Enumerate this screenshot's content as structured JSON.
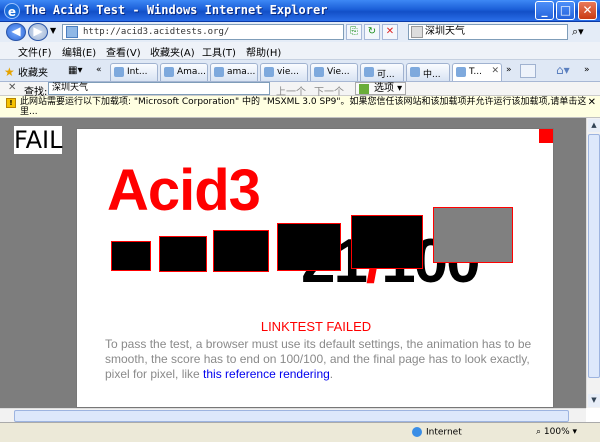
{
  "window": {
    "title": "The Acid3 Test - Windows Internet Explorer"
  },
  "address": {
    "url": "http://acid3.acidtests.org/",
    "search_value": "深圳天气"
  },
  "menu": [
    "文件(F)",
    "编辑(E)",
    "查看(V)",
    "收藏夹(A)",
    "工具(T)",
    "帮助(H)"
  ],
  "favorites_label": "收藏夹",
  "tabs": [
    "Int...",
    "Ama...",
    "ama...",
    "vie...",
    "Vie...",
    "可...",
    "中...",
    "T..."
  ],
  "find": {
    "label": "查找:",
    "value": "深圳天气",
    "prev": "上一个",
    "next": "下一个",
    "options": "选项"
  },
  "infobar": {
    "text": "此网站需要运行以下加载项: \"Microsoft Corporation\" 中的 \"MSXML 3.0 SP9\"。如果您信任该网站和该加载项并允许运行该加载项,请单击这里..."
  },
  "page": {
    "fail_text": "FAIL",
    "acid_title": "Acid3",
    "score_value": "21",
    "score_slash": "/",
    "score_total": "100",
    "status_message": "LINKTEST FAILED",
    "description": "To pass the test, a browser must use its default settings, the animation has to be smooth, the score has to end on 100/100, and the final page has to look exactly, pixel for pixel, like ",
    "reference_link": "this reference rendering",
    "description_end": "."
  },
  "status": {
    "zone": "Internet",
    "zoom": "100%"
  },
  "colors": {
    "acid_red": "#ff0000",
    "link": "#0000ee",
    "description_gray": "#8a8a8a"
  }
}
